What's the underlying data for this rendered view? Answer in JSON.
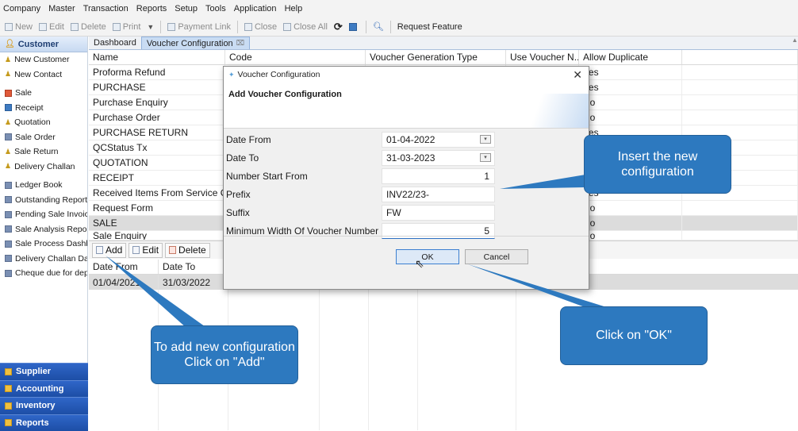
{
  "menu": [
    "Company",
    "Master",
    "Transaction",
    "Reports",
    "Setup",
    "Tools",
    "Application",
    "Help"
  ],
  "toolbar": {
    "new": "New",
    "edit": "Edit",
    "delete": "Delete",
    "print": "Print",
    "payment_link": "Payment Link",
    "close": "Close",
    "close_all": "Close All",
    "request_feature": "Request Feature"
  },
  "sidebar": {
    "header": "Customer",
    "items": [
      {
        "label": "New Customer",
        "icon": "person-icon"
      },
      {
        "label": "New Contact",
        "icon": "person-icon"
      },
      {
        "label": "Sale",
        "icon": "sale-icon"
      },
      {
        "label": "Receipt",
        "icon": "receipt-icon"
      },
      {
        "label": "Quotation",
        "icon": "person-icon"
      },
      {
        "label": "Sale Order",
        "icon": "document-icon"
      },
      {
        "label": "Sale Return",
        "icon": "person-icon"
      },
      {
        "label": "Delivery Challan",
        "icon": "person-icon"
      },
      {
        "label": "Ledger Book",
        "icon": "report-icon"
      },
      {
        "label": "Outstanding Report",
        "icon": "report-icon"
      },
      {
        "label": "Pending Sale Invoices",
        "icon": "report-icon"
      },
      {
        "label": "Sale Analysis Report",
        "icon": "report-icon"
      },
      {
        "label": "Sale Process Dashboard",
        "icon": "report-icon"
      },
      {
        "label": "Delivery Challan Dashboard",
        "icon": "report-icon"
      },
      {
        "label": "Cheque due for deposit",
        "icon": "report-icon"
      }
    ],
    "bottom": [
      "Supplier",
      "Accounting",
      "Inventory",
      "Reports"
    ]
  },
  "tabs": [
    {
      "label": "Dashboard",
      "active": false
    },
    {
      "label": "Voucher Configuration",
      "active": true
    }
  ],
  "grid": {
    "columns": [
      "Name",
      "Code",
      "Voucher Generation Type",
      "Use Voucher N...",
      "Allow Duplicate"
    ],
    "rows": [
      {
        "name": "Proforma Refund",
        "allow": "Yes"
      },
      {
        "name": "PURCHASE",
        "allow": "Yes"
      },
      {
        "name": "Purchase Enquiry",
        "allow": "No"
      },
      {
        "name": "Purchase Order",
        "allow": "No"
      },
      {
        "name": "PURCHASE RETURN",
        "allow": "Yes"
      },
      {
        "name": "QCStatus Tx",
        "allow": ""
      },
      {
        "name": "QUOTATION",
        "allow": ""
      },
      {
        "name": "RECEIPT",
        "allow": ""
      },
      {
        "name": "Received Items From Service C...",
        "allow": "Yes"
      },
      {
        "name": "Request Form",
        "allow": "No"
      },
      {
        "name": "SALE",
        "allow": "No"
      },
      {
        "name": "Sale Enquiry",
        "allow": "No"
      }
    ]
  },
  "lower": {
    "buttons": {
      "add": "Add",
      "edit": "Edit",
      "delete": "Delete"
    },
    "columns": [
      "Date From",
      "Date To"
    ],
    "row": {
      "date_from": "01/04/2021",
      "date_to": "31/03/2022"
    }
  },
  "dialog": {
    "title": "Voucher Configuration",
    "heading": "Add Voucher Configuration",
    "fields": {
      "date_from": {
        "label": "Date From",
        "value": "01-04-2022"
      },
      "date_to": {
        "label": "Date To",
        "value": "31-03-2023"
      },
      "number_start": {
        "label": "Number Start From",
        "value": "1"
      },
      "prefix": {
        "label": "Prefix",
        "value": "INV22/23-"
      },
      "suffix": {
        "label": "Suffix",
        "value": "FW"
      },
      "min_width": {
        "label": "Minimum Width Of Voucher Number",
        "value": "5"
      }
    },
    "ok": "OK",
    "cancel": "Cancel"
  },
  "callouts": {
    "insert": "Insert the new configuration",
    "add": "To add new configuration Click on \"Add\"",
    "ok": "Click on \"OK\""
  },
  "colors": {
    "accent": "#2d79bf",
    "sidebar_bottom": "#1d4ea6",
    "selected_row": "#dcdcdc"
  }
}
